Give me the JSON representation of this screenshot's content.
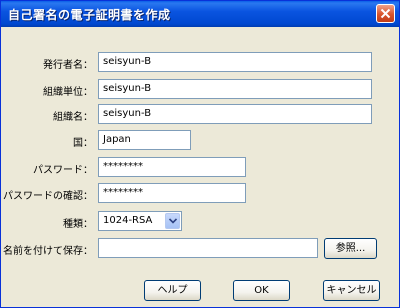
{
  "window": {
    "title": "自己署名の電子証明書を作成"
  },
  "form": {
    "issuer_label": "発行者名：",
    "issuer_value": "seisyun-B",
    "org_unit_label": "組織単位：",
    "org_unit_value": "seisyun-B",
    "org_name_label": "組織名：",
    "org_name_value": "seisyun-B",
    "country_label": "国：",
    "country_value": "Japan",
    "password_label": "パスワード：",
    "password_value": "********",
    "password_confirm_label": "パスワードの確認：",
    "password_confirm_value": "********",
    "type_label": "種類：",
    "type_value": "1024-RSA",
    "save_as_label": "名前を付けて保存：",
    "save_as_value": "",
    "browse_label": "参照..."
  },
  "buttons": {
    "help": "ヘルプ",
    "ok": "OK",
    "cancel": "キャンセル"
  },
  "icons": {
    "close": "close-icon",
    "dropdown": "chevron-down-icon"
  },
  "colors": {
    "titlebar": "#0a54e0",
    "dialog_bg": "#ece9d8",
    "close_button": "#d8542c",
    "field_border": "#7f9db9"
  }
}
